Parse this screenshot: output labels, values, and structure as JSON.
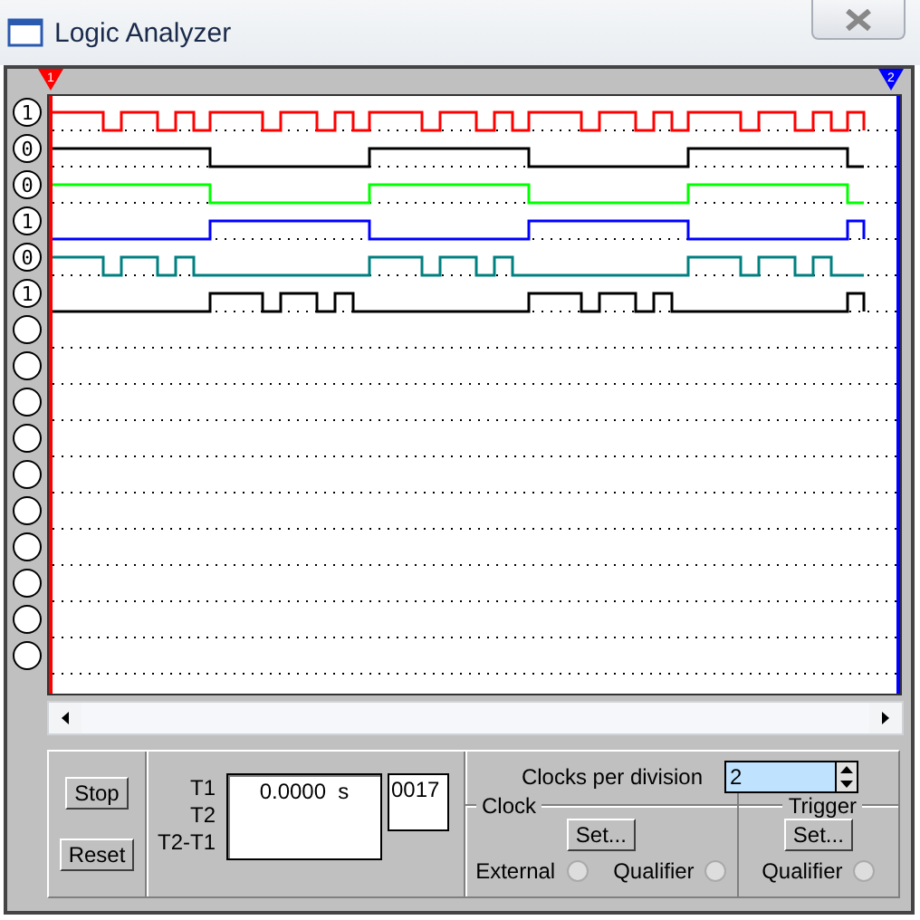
{
  "window": {
    "title": "Logic Analyzer"
  },
  "cursors": [
    {
      "label": "1",
      "color": "#ff0000"
    },
    {
      "label": "2",
      "color": "#0000ff"
    }
  ],
  "channels": [
    {
      "value": "1",
      "kind": "burst-clock",
      "color": "#ff0000"
    },
    {
      "value": "0",
      "kind": "high-first",
      "color": "#000000"
    },
    {
      "value": "0",
      "kind": "high-first",
      "color": "#00ff00"
    },
    {
      "value": "1",
      "kind": "low-first",
      "color": "#0000ff"
    },
    {
      "value": "0",
      "kind": "burst-first",
      "color": "#008080"
    },
    {
      "value": "1",
      "kind": "burst-second",
      "color": "#000000"
    },
    {
      "kind": "none"
    },
    {
      "kind": "none"
    },
    {
      "kind": "none"
    },
    {
      "kind": "none"
    },
    {
      "kind": "none"
    },
    {
      "kind": "none"
    },
    {
      "kind": "none"
    },
    {
      "kind": "none"
    },
    {
      "kind": "none"
    },
    {
      "kind": "none"
    }
  ],
  "controls": {
    "buttons": [
      "Stop",
      "Reset"
    ],
    "time_labels": [
      "T1",
      "T2",
      "T2-T1"
    ],
    "time_readout": "0.0000  s",
    "count_readout": "0017",
    "clocks_per_division": {
      "label": "Clocks per division",
      "value": "2"
    },
    "clock": {
      "title": "Clock",
      "button": "Set...",
      "options": [
        {
          "label": "External",
          "selected": false
        },
        {
          "label": "Qualifier",
          "selected": false
        }
      ]
    },
    "trigger": {
      "title": "Trigger",
      "button": "Set...",
      "options": [
        {
          "label": "Qualifier",
          "selected": false
        }
      ]
    }
  }
}
